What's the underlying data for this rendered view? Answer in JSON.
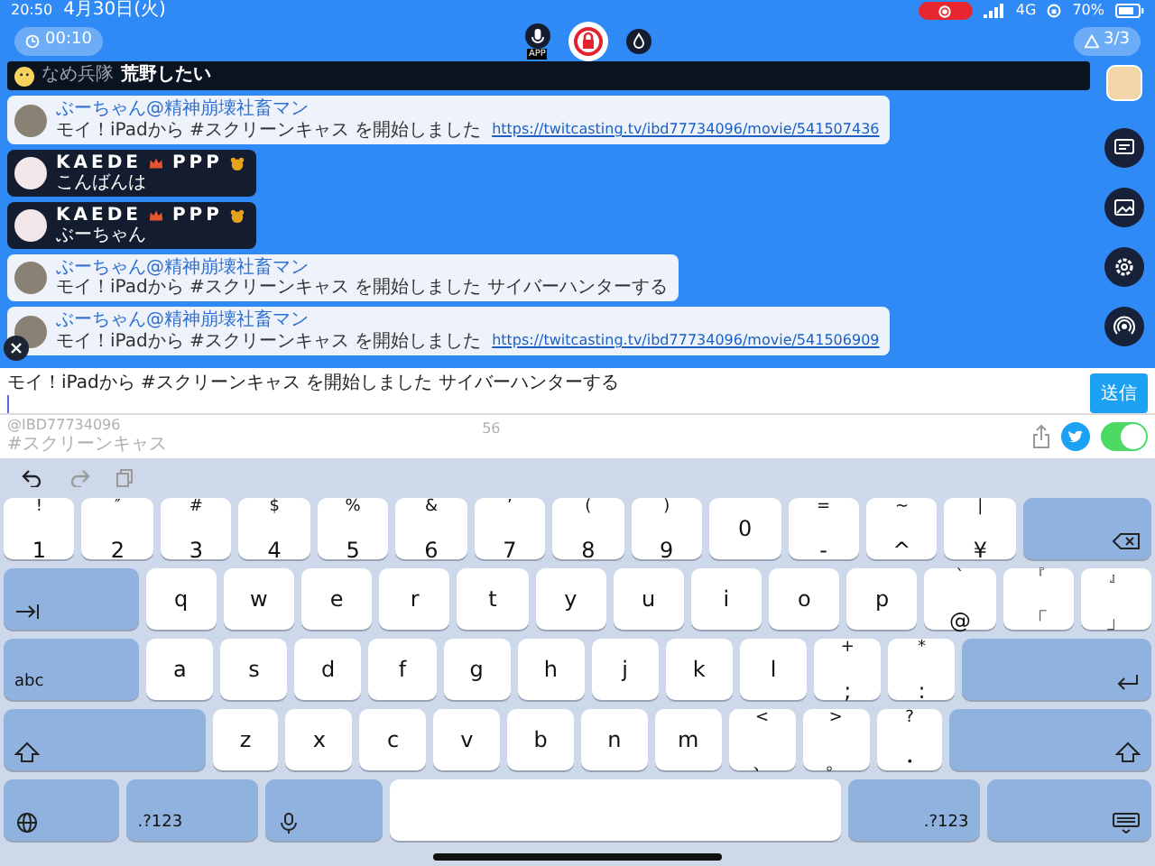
{
  "status_bar": {
    "time": "20:50",
    "date": "4月30日(火)",
    "network": "4G",
    "battery": "70%"
  },
  "stream_controls": {
    "timer": "00:10",
    "mic_label": "APP",
    "viewers": "3/3"
  },
  "pinned_comment": {
    "user": "なめ兵隊",
    "text": "荒野したい"
  },
  "comments": [
    {
      "kind": "light",
      "name": "ぶーちゃん@精神崩壊社畜マン",
      "text": "モイ！iPadから #スクリーンキャス を開始しました",
      "link": "https://twitcasting.tv/ibd77734096/movie/541507436"
    },
    {
      "kind": "dark",
      "name": "KAEDE",
      "name_suffix": "PPP",
      "text": "こんばんは"
    },
    {
      "kind": "dark",
      "name": "KAEDE",
      "name_suffix": "PPP",
      "text": "ぶーちゃん"
    },
    {
      "kind": "light",
      "name": "ぶーちゃん@精神崩壊社畜マン",
      "text": "モイ！iPadから #スクリーンキャス を開始しました サイバーハンターする"
    },
    {
      "kind": "light",
      "name": "ぶーちゃん@精神崩壊社畜マン",
      "text": "モイ！iPadから #スクリーンキャス を開始しました",
      "link": "https://twitcasting.tv/ibd77734096/movie/541506909"
    }
  ],
  "comment_form": {
    "value": "モイ！iPadから #スクリーンキャス を開始しました サイバーハンターする",
    "send_button": "送信",
    "account": "@IBD77734096",
    "char_count": "56",
    "hashtag": "#スクリーンキャス",
    "tweet_toggle": {
      "on": true
    }
  },
  "keyboard": {
    "rows": [
      [
        {
          "kind": "char",
          "top": "!",
          "main": "1"
        },
        {
          "kind": "char",
          "top": "″",
          "main": "2"
        },
        {
          "kind": "char",
          "top": "#",
          "main": "3"
        },
        {
          "kind": "char",
          "top": "$",
          "main": "4"
        },
        {
          "kind": "char",
          "top": "%",
          "main": "5"
        },
        {
          "kind": "char",
          "top": "&",
          "main": "6"
        },
        {
          "kind": "char",
          "top": "’",
          "main": "7"
        },
        {
          "kind": "char",
          "top": "(",
          "main": "8"
        },
        {
          "kind": "char",
          "top": ")",
          "main": "9"
        },
        {
          "kind": "char",
          "main": "0"
        },
        {
          "kind": "char",
          "top": "=",
          "main": "-"
        },
        {
          "kind": "char",
          "top": "~",
          "main": "^"
        },
        {
          "kind": "char",
          "top": "|",
          "main": "¥"
        },
        {
          "kind": "delete"
        }
      ],
      [
        {
          "kind": "tab"
        },
        {
          "kind": "char",
          "main": "q"
        },
        {
          "kind": "char",
          "main": "w"
        },
        {
          "kind": "char",
          "main": "e"
        },
        {
          "kind": "char",
          "main": "r"
        },
        {
          "kind": "char",
          "main": "t"
        },
        {
          "kind": "char",
          "main": "y"
        },
        {
          "kind": "char",
          "main": "u"
        },
        {
          "kind": "char",
          "main": "i"
        },
        {
          "kind": "char",
          "main": "o"
        },
        {
          "kind": "char",
          "main": "p"
        },
        {
          "kind": "char",
          "top": "`",
          "main": "@"
        },
        {
          "kind": "char",
          "top": "『",
          "main": "「"
        },
        {
          "kind": "char",
          "top": "』",
          "main": "」"
        }
      ],
      [
        {
          "kind": "mode",
          "label": "abc"
        },
        {
          "kind": "char",
          "main": "a"
        },
        {
          "kind": "char",
          "main": "s"
        },
        {
          "kind": "char",
          "main": "d"
        },
        {
          "kind": "char",
          "main": "f"
        },
        {
          "kind": "char",
          "main": "g"
        },
        {
          "kind": "char",
          "main": "h"
        },
        {
          "kind": "char",
          "main": "j"
        },
        {
          "kind": "char",
          "main": "k"
        },
        {
          "kind": "char",
          "main": "l"
        },
        {
          "kind": "char",
          "top": "+",
          "main": ";"
        },
        {
          "kind": "char",
          "top": "*",
          "main": ":"
        },
        {
          "kind": "return"
        }
      ],
      [
        {
          "kind": "shift"
        },
        {
          "kind": "char",
          "main": "z"
        },
        {
          "kind": "char",
          "main": "x"
        },
        {
          "kind": "char",
          "main": "c"
        },
        {
          "kind": "char",
          "main": "v"
        },
        {
          "kind": "char",
          "main": "b"
        },
        {
          "kind": "char",
          "main": "n"
        },
        {
          "kind": "char",
          "main": "m"
        },
        {
          "kind": "char",
          "top": "<",
          "main": "、"
        },
        {
          "kind": "char",
          "top": ">",
          "main": "。"
        },
        {
          "kind": "char",
          "top": "?",
          "main": "・"
        },
        {
          "kind": "shift"
        }
      ],
      [
        {
          "kind": "globe"
        },
        {
          "kind": "mode",
          "label": ".?123"
        },
        {
          "kind": "mic"
        },
        {
          "kind": "space"
        },
        {
          "kind": "mode",
          "label": ".?123"
        },
        {
          "kind": "hide"
        }
      ]
    ]
  }
}
